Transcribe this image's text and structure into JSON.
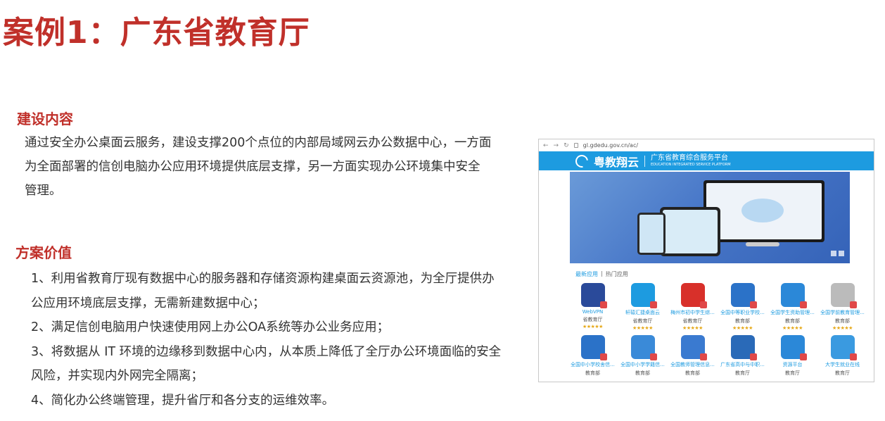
{
  "slide": {
    "title": "案例1：广东省教育厅",
    "sections": [
      {
        "heading": "建设内容",
        "text_lines": [
          "通过安全办公桌面云服务，建设支撑200个点位的内部局域网云办公数据中心，一方面",
          "为全面部署的信创电脑办公应用环境提供底层支撑，另一方面实现办公环境集中安全",
          "管理。"
        ]
      },
      {
        "heading": "方案价值",
        "points": [
          "1、利用省教育厅现有数据中心的服务器和存储资源构建桌面云资源池，为全厅提供办",
          "公应用环境底层支撑，无需新建数据中心；",
          "2、满足信创电脑用户快速使用网上办公OA系统等办公业务应用；",
          "3、将数据从 IT 环境的边缘移到数据中心内，从本质上降低了全厅办公环境面临的安全",
          "风险，并实现内外网完全隔离；",
          "4、简化办公终端管理，提升省厅和各分支的运维效率。"
        ]
      }
    ]
  },
  "browser": {
    "url": "gl.gdedu.gov.cn/ac/",
    "site_logo": "粤教翔云",
    "site_title": "广东省教育综合服务平台",
    "site_subtitle": "EDUCATION INTEGRATED SERVICE PLATFORM",
    "tabs": [
      "最新应用",
      "|",
      "热门应用"
    ],
    "apps": [
      {
        "name": "WebVPN",
        "owner": "省教育厅",
        "stars": "★★★★★",
        "color": "#2a4a9a",
        "icon": "h-logo-icon"
      },
      {
        "name": "轩辕汇捷桌面云",
        "owner": "省教育厅",
        "stars": "★★★★★",
        "color": "#1d9be0",
        "icon": "cloud-ring-icon"
      },
      {
        "name": "梅州市初中学生综...",
        "owner": "省教育厅",
        "stars": "★★★★★",
        "color": "#d8302a",
        "icon": "flower-emblem-icon"
      },
      {
        "name": "全国中等职业学校...",
        "owner": "教育部",
        "stars": "★★★★★",
        "color": "#2b72c8",
        "icon": "grad-cap-icon"
      },
      {
        "name": "全国学生资助管理...",
        "owner": "教育部",
        "stars": "★★★★★",
        "color": "#2b88d8",
        "icon": "shield-icon"
      },
      {
        "name": "全国学前教育管理...",
        "owner": "教育部",
        "stars": "★★★★★",
        "color": "#bbbbbb",
        "icon": "broken-image-icon"
      },
      {
        "name": "全国中小学校舍信...",
        "owner": "教育部",
        "stars": "",
        "color": "#2b72c8",
        "icon": "building-icon"
      },
      {
        "name": "全国中小学学籍信...",
        "owner": "教育部",
        "stars": "",
        "color": "#3a8ad8",
        "icon": "id-card-icon"
      },
      {
        "name": "全国教师管理信息...",
        "owner": "教育部",
        "stars": "",
        "color": "#3a7ad0",
        "icon": "teacher-icon"
      },
      {
        "name": "广东省高中与中职...",
        "owner": "教育厅",
        "stars": "",
        "color": "#2a6ab8",
        "icon": "book-icon"
      },
      {
        "name": "资源平台",
        "owner": "教育厅",
        "stars": "",
        "color": "#2b88d8",
        "icon": "briefcase-icon"
      },
      {
        "name": "大学生就业在线",
        "owner": "教育厅",
        "stars": "",
        "color": "#3a9ae0",
        "icon": "lightbulb-icon"
      }
    ]
  }
}
